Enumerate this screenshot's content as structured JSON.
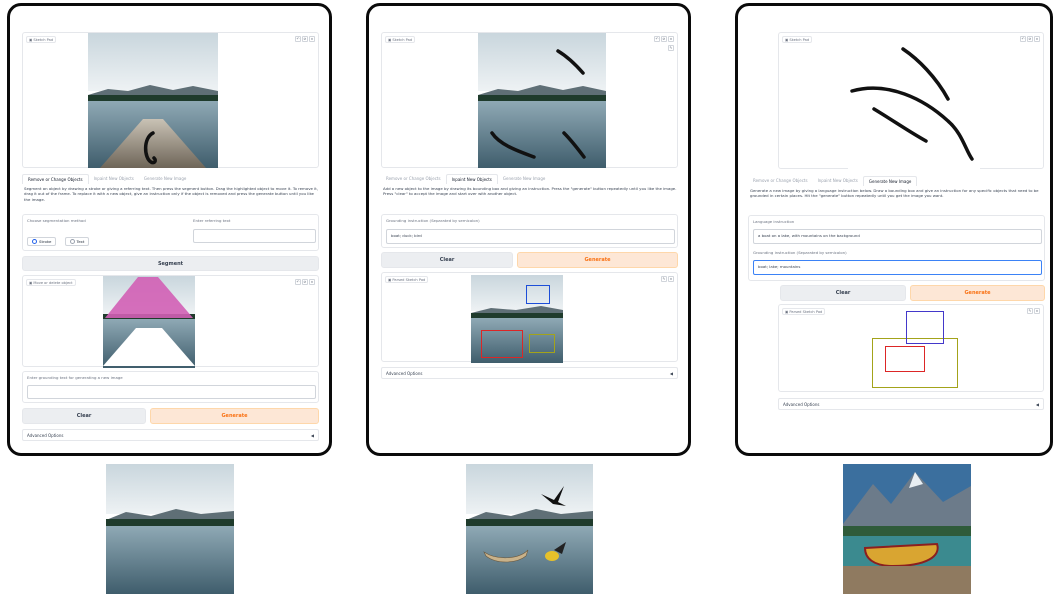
{
  "tabs": [
    "Remove or Change Objects",
    "Inpaint New Objects",
    "Generate New Image"
  ],
  "panel1": {
    "sketch_label": "Sketch Pad",
    "description": "Segment an object by drawing a stroke or giving a referring text. Then press the segment button. Drag the highlighted object to move it. To remove it, drag it out of the frame. To replace it with a new object, give an instruction only if the object is removed and press the generate button until you like the image.",
    "seg_method_label": "Choose segmentation method",
    "seg_options": [
      "Stroke",
      "Text"
    ],
    "referring_label": "Enter referring text",
    "segment_button": "Segment",
    "move_label": "Move or delete object",
    "grounding_label": "Enter grounding text for generating a new image",
    "clear_button": "Clear",
    "generate_button": "Generate",
    "advanced": "Advanced Options"
  },
  "panel2": {
    "sketch_label": "Sketch Pad",
    "description": "Add a new object to the image by drawing its bounding box and giving an instruction. Press the \"generate\" button repeatedly until you like the image. Press \"clear\" to accept the image and start over with another object.",
    "grounding_label": "Grounding instruction (Separated by semicolon)",
    "grounding_value": "boat; duck; bird",
    "clear_button": "Clear",
    "generate_button": "Generate",
    "parsed_label": "Parsed Sketch Pad",
    "advanced": "Advanced Options"
  },
  "panel3": {
    "sketch_label": "Sketch Pad",
    "description": "Generate a new image by giving a language instruction below. Draw a bounding box and give an instruction for any specific objects that need to be grounded in certain places. Hit the \"generate\" button repeatedly until you get the image you want.",
    "language_label": "Language instruction",
    "language_value": "a boat on a lake, with mountains on the background",
    "grounding_label": "Grounding instruction (Separated by semicolon)",
    "grounding_value": "boat; lake; mountains",
    "clear_button": "Clear",
    "generate_button": "Generate",
    "parsed_label": "Parsed Sketch Pad",
    "advanced": "Advanced Options"
  },
  "colors": {
    "accent": "#f97316",
    "primary_bg": "#fde7d6",
    "radio": "#2563eb",
    "border": "#0a0a0a"
  }
}
